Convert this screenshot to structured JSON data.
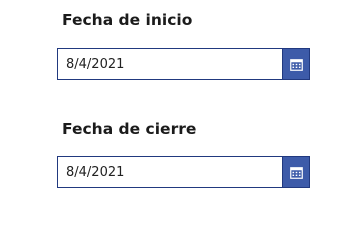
{
  "form": {
    "start_date": {
      "label": "Fecha de inicio",
      "value": "8/4/2021",
      "icon": "calendar-icon"
    },
    "end_date": {
      "label": "Fecha de cierre",
      "value": "8/4/2021",
      "icon": "calendar-icon"
    }
  },
  "colors": {
    "border": "#21397f",
    "button": "#3d5ba9",
    "label_text": "#1b1b1b"
  }
}
